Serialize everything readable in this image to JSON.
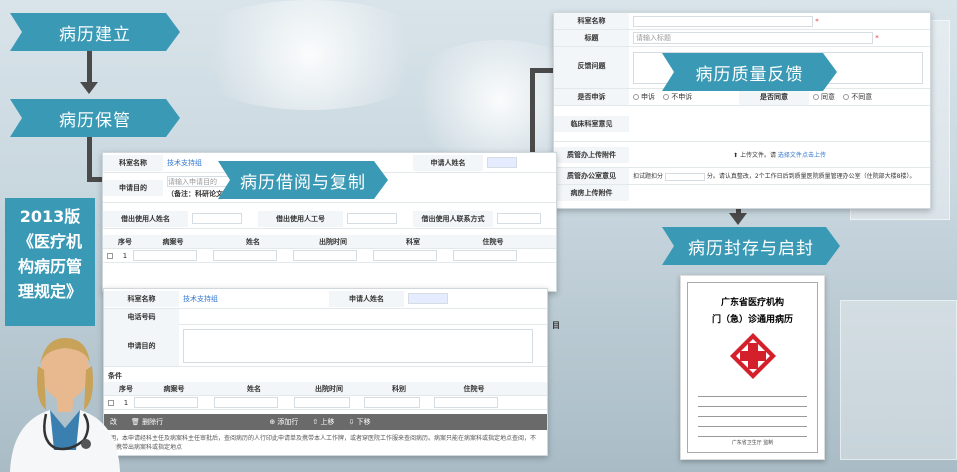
{
  "steps": {
    "create": "病历建立",
    "keep": "病历保管",
    "borrow": "病历借阅与复制",
    "feedback": "病历质量反馈",
    "seal": "病历封存与启封"
  },
  "side_title": {
    "line1": "2013版",
    "line2": "《医疗机",
    "line3": "构病历管",
    "line4": "理规定》"
  },
  "borrow_form": {
    "dept_label": "科室名称",
    "dept_value": "技术支持组",
    "applicant_label": "申请人姓名",
    "purpose_label": "申请目的",
    "purpose_placeholder": "请输入申请目的",
    "note": "（备注：科研论文目的只能查阅，不能借阅）",
    "user_name_label": "借出使用人姓名",
    "user_id_label": "借出使用人工号",
    "user_phone_label": "借出使用人联系方式",
    "grid_headers": [
      "序号",
      "病案号",
      "姓名",
      "出院时间",
      "科室",
      "住院号"
    ],
    "grid_row_no": "1"
  },
  "copy_form": {
    "dept_label": "科室名称",
    "dept_value": "技术支持组",
    "applicant_label": "申请人姓名",
    "phone_label": "电话号码",
    "purpose_label": "申请目的",
    "section": "条件",
    "grid_headers": [
      "序号",
      "病案号",
      "姓名",
      "出院时间",
      "科别",
      "住院号"
    ],
    "grid_row_no": "1",
    "toolbar": {
      "delete": "删除行",
      "add": "添加行",
      "up": "上移",
      "down": "下移",
      "edit_suffix": "改"
    },
    "footer": "明，本申请经科主任及病案科主任审批后，查阅病历的人行印此申请单及携带本人工作牌，或者穿医院工作服来查阅病历。病案只能在病案科或指定地点查阅，不能携带出病案科或指定地点",
    "side_char": "目"
  },
  "feedback_form": {
    "dept_label": "科室名称",
    "title_label": "标题",
    "title_placeholder": "请输入标题",
    "content_label": "反馈问题",
    "opt1_label": "是否申诉",
    "opt1_yes": "申诉",
    "opt1_no": "不申诉",
    "opt2_label": "是否同意",
    "opt2_yes": "同意",
    "opt2_no": "不同意",
    "clinical_label": "临床科室意见",
    "attach_label": "质管办上传附件",
    "upload_text": "上传文件。请",
    "upload_link": "选择文件",
    "upload_suffix": "点击上传",
    "office_label": "质管办公室意见",
    "office_text1": "扣试题扣分",
    "office_text2": "分。请认真整改，2个工作日后到质量医院质量管理办公室（住院部大楼8楼）。",
    "hospital_attach_label": "病房上传附件"
  },
  "document": {
    "org": "广东省医疗机构",
    "title": "门（急）诊通用病历",
    "footer": "广东省卫生厅 监制"
  },
  "colors": {
    "step_bg": "#3a9ab6",
    "arrow": "#4a4a4a",
    "red_cross": "#d4202a"
  }
}
